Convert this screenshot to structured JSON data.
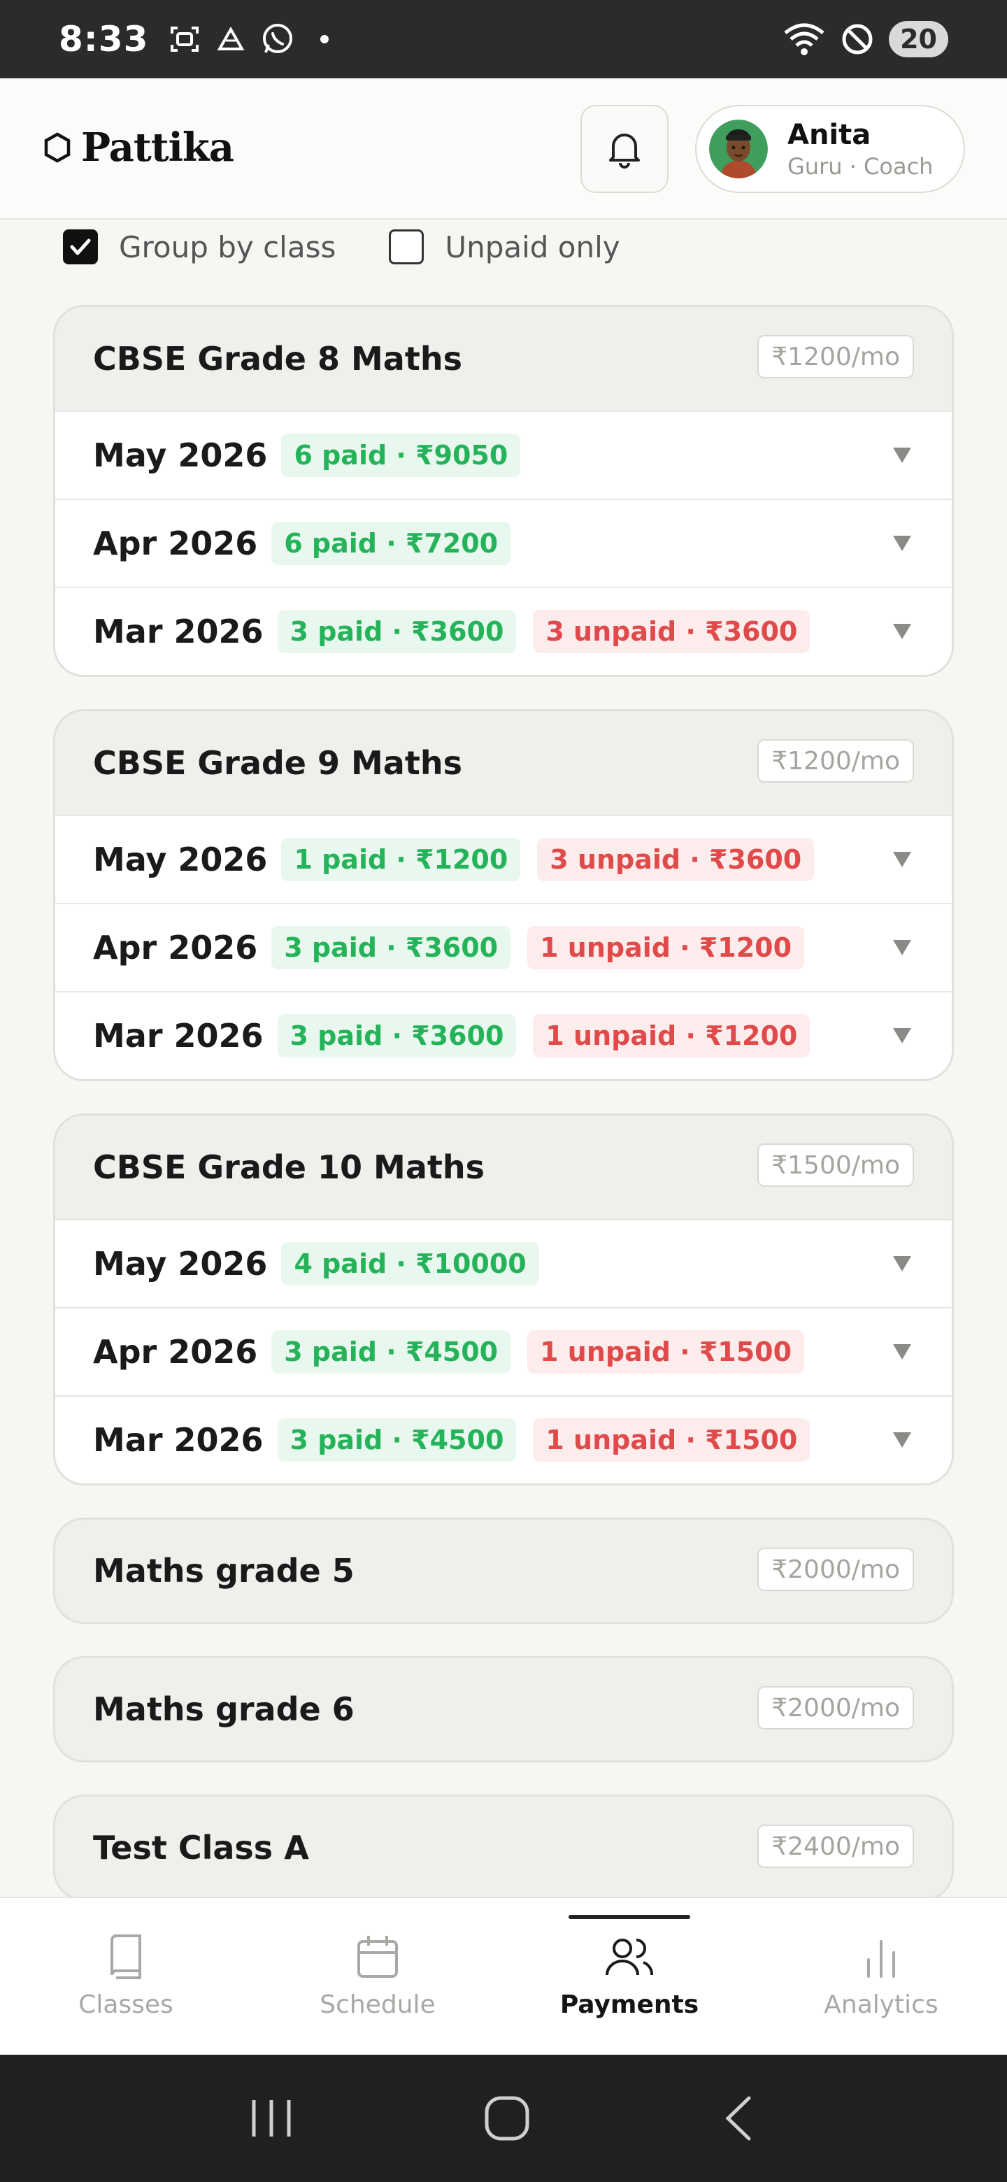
{
  "status_bar": {
    "time": "8:33",
    "battery": "20",
    "left_icons": [
      "screenshot-icon",
      "drive-icon",
      "whatsapp-icon",
      "dot-icon"
    ],
    "right_icons": [
      "wifi-icon",
      "do-not-disturb-icon",
      "battery-icon"
    ]
  },
  "header": {
    "brand": "Pattika",
    "brand_icon": "hexagon-icon",
    "notification_icon": "bell-icon",
    "user": {
      "name": "Anita",
      "role": "Guru · Coach"
    }
  },
  "filters": {
    "group_by_class": {
      "label": "Group by class",
      "checked": true
    },
    "unpaid_only": {
      "label": "Unpaid only",
      "checked": false
    }
  },
  "classes": [
    {
      "name": "CBSE Grade 8 Maths",
      "price": "₹1200/mo",
      "months": [
        {
          "label": "May 2026",
          "paid": "6 paid · ₹9050",
          "unpaid": null
        },
        {
          "label": "Apr 2026",
          "paid": "6 paid · ₹7200",
          "unpaid": null
        },
        {
          "label": "Mar 2026",
          "paid": "3 paid · ₹3600",
          "unpaid": "3 unpaid · ₹3600"
        }
      ]
    },
    {
      "name": "CBSE Grade 9 Maths",
      "price": "₹1200/mo",
      "months": [
        {
          "label": "May 2026",
          "paid": "1 paid · ₹1200",
          "unpaid": "3 unpaid · ₹3600"
        },
        {
          "label": "Apr 2026",
          "paid": "3 paid · ₹3600",
          "unpaid": "1 unpaid · ₹1200"
        },
        {
          "label": "Mar 2026",
          "paid": "3 paid · ₹3600",
          "unpaid": "1 unpaid · ₹1200"
        }
      ]
    },
    {
      "name": "CBSE Grade 10 Maths",
      "price": "₹1500/mo",
      "months": [
        {
          "label": "May 2026",
          "paid": "4 paid · ₹10000",
          "unpaid": null
        },
        {
          "label": "Apr 2026",
          "paid": "3 paid · ₹4500",
          "unpaid": "1 unpaid · ₹1500"
        },
        {
          "label": "Mar 2026",
          "paid": "3 paid · ₹4500",
          "unpaid": "1 unpaid · ₹1500"
        }
      ]
    },
    {
      "name": "Maths grade 5",
      "price": "₹2000/mo",
      "months": []
    },
    {
      "name": "Maths grade 6",
      "price": "₹2000/mo",
      "months": []
    },
    {
      "name": "Test Class A",
      "price": "₹2400/mo",
      "months": []
    }
  ],
  "bottom_nav": {
    "items": [
      {
        "label": "Classes",
        "icon": "book-icon",
        "active": false
      },
      {
        "label": "Schedule",
        "icon": "calendar-icon",
        "active": false
      },
      {
        "label": "Payments",
        "icon": "users-icon",
        "active": true
      },
      {
        "label": "Analytics",
        "icon": "bar-chart-icon",
        "active": false
      }
    ]
  },
  "system_nav": {
    "icons": [
      "recents-icon",
      "home-icon",
      "back-icon"
    ]
  },
  "colors": {
    "paid_text": "#25b35a",
    "paid_bg": "#e9f8ee",
    "unpaid_text": "#e04a4a",
    "unpaid_bg": "#fdecec",
    "card_head_bg": "#efefec",
    "page_bg": "#f6f6f3"
  }
}
